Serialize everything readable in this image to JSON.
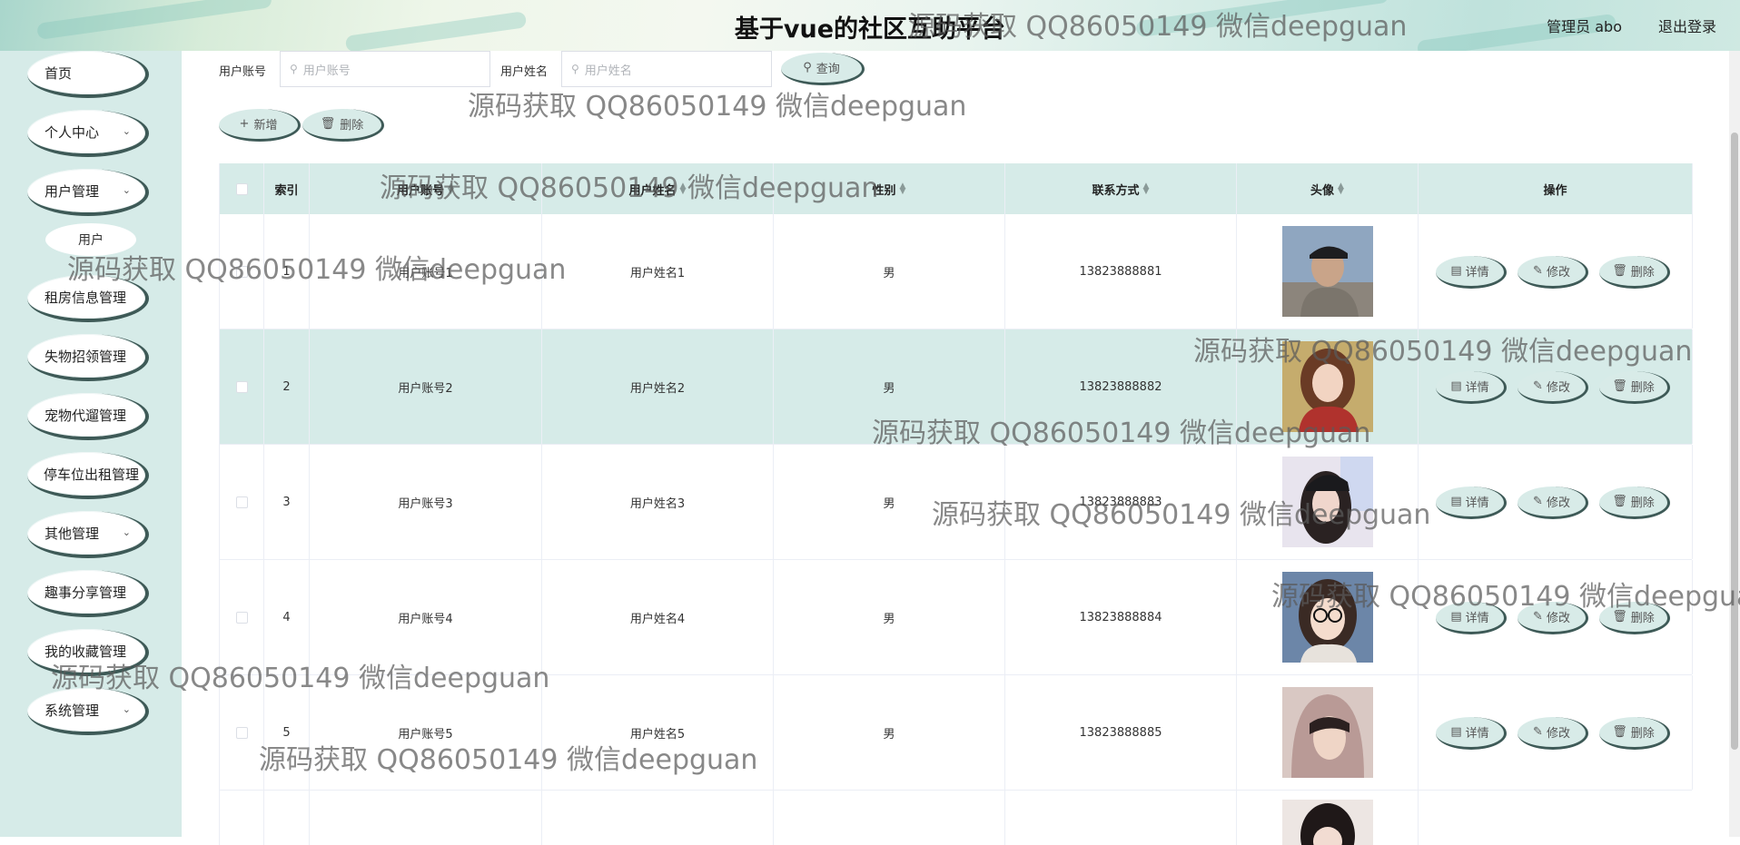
{
  "header": {
    "title": "基于vue的社区互助平台",
    "user": "管理员 abo",
    "logout": "退出登录"
  },
  "sidebar": {
    "items": [
      {
        "label": "首页",
        "has_children": false
      },
      {
        "label": "个人中心",
        "has_children": true
      },
      {
        "label": "用户管理",
        "has_children": true
      },
      {
        "label": "租房信息管理",
        "has_children": false
      },
      {
        "label": "失物招领管理",
        "has_children": false
      },
      {
        "label": "宠物代遛管理",
        "has_children": false
      },
      {
        "label": "停车位出租管理",
        "has_children": false
      },
      {
        "label": "其他管理",
        "has_children": true
      },
      {
        "label": "趣事分享管理",
        "has_children": false
      },
      {
        "label": "我的收藏管理",
        "has_children": false
      },
      {
        "label": "系统管理",
        "has_children": true
      }
    ],
    "sub_item": "用户"
  },
  "search": {
    "account_label": "用户账号",
    "account_placeholder": "用户账号",
    "name_label": "用户姓名",
    "name_placeholder": "用户姓名",
    "query_button": "查询"
  },
  "actions": {
    "add": "新增",
    "delete": "删除"
  },
  "table": {
    "columns": [
      "索引",
      "用户账号",
      "用户姓名",
      "性别",
      "联系方式",
      "头像",
      "操作"
    ],
    "rows": [
      {
        "index": "1",
        "account": "用户账号1",
        "name": "用户姓名1",
        "gender": "男",
        "phone": "13823888881"
      },
      {
        "index": "2",
        "account": "用户账号2",
        "name": "用户姓名2",
        "gender": "男",
        "phone": "13823888882"
      },
      {
        "index": "3",
        "account": "用户账号3",
        "name": "用户姓名3",
        "gender": "男",
        "phone": "13823888883"
      },
      {
        "index": "4",
        "account": "用户账号4",
        "name": "用户姓名4",
        "gender": "男",
        "phone": "13823888884"
      },
      {
        "index": "5",
        "account": "用户账号5",
        "name": "用户姓名5",
        "gender": "男",
        "phone": "13823888885"
      }
    ],
    "op_detail": "详情",
    "op_edit": "修改",
    "op_delete": "删除"
  },
  "watermark": "源码获取 QQ86050149 微信deepguan",
  "colors": {
    "accent": "#d6ebe8",
    "button_shadow": "#3e5a57"
  }
}
